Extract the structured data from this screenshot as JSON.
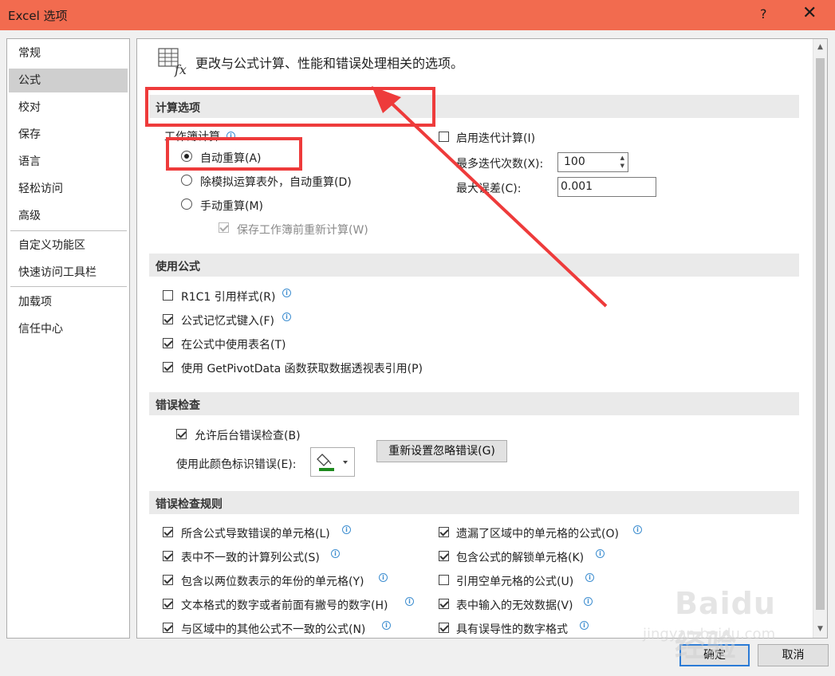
{
  "window": {
    "title": "Excel 选项",
    "help": "?",
    "close": "✕"
  },
  "nav": {
    "items": [
      "常规",
      "公式",
      "校对",
      "保存",
      "语言",
      "轻松访问",
      "高级",
      "自定义功能区",
      "快速访问工具栏",
      "加载项",
      "信任中心"
    ],
    "active_index": 1
  },
  "header": {
    "text": "更改与公式计算、性能和错误处理相关的选项。"
  },
  "calc": {
    "section": "计算选项",
    "workbook_calc_label": "工作簿计算",
    "radio_auto": "自动重算(A)",
    "radio_auto_except": "除模拟运算表外，自动重算(D)",
    "radio_manual": "手动重算(M)",
    "recalc_before_save": "保存工作簿前重新计算(W)",
    "enable_iterative": "启用迭代计算(I)",
    "max_iterations_label": "最多迭代次数(X):",
    "max_iterations_value": "100",
    "max_change_label": "最大误差(C):",
    "max_change_value": "0.001"
  },
  "formulas": {
    "section": "使用公式",
    "r1c1": "R1C1 引用样式(R)",
    "autocomplete": "公式记忆式键入(F)",
    "table_names": "在公式中使用表名(T)",
    "getpivotdata": "使用 GetPivotData 函数获取数据透视表引用(P)"
  },
  "errorcheck": {
    "section": "错误检查",
    "enable_bg": "允许后台错误检查(B)",
    "color_label": "使用此颜色标识错误(E):",
    "reset_button": "重新设置忽略错误(G)",
    "color_accent": "#1e8a1e"
  },
  "rules": {
    "section": "错误检查规则",
    "left": [
      "所含公式导致错误的单元格(L)",
      "表中不一致的计算列公式(S)",
      "包含以两位数表示的年份的单元格(Y)",
      "文本格式的数字或者前面有撇号的数字(H)",
      "与区域中的其他公式不一致的公式(N)"
    ],
    "right": [
      "遗漏了区域中的单元格的公式(O)",
      "包含公式的解锁单元格(K)",
      "引用空单元格的公式(U)",
      "表中输入的无效数据(V)",
      "具有误导性的数字格式"
    ]
  },
  "footer": {
    "ok": "确定",
    "cancel": "取消"
  },
  "watermark": {
    "logo": "Baidu 经验",
    "url": "jingyan.baidu.com"
  },
  "colors": {
    "titlebar": "#f26b4f",
    "annotation_red": "#ee3b3b",
    "info_blue": "#3e8ed0"
  }
}
